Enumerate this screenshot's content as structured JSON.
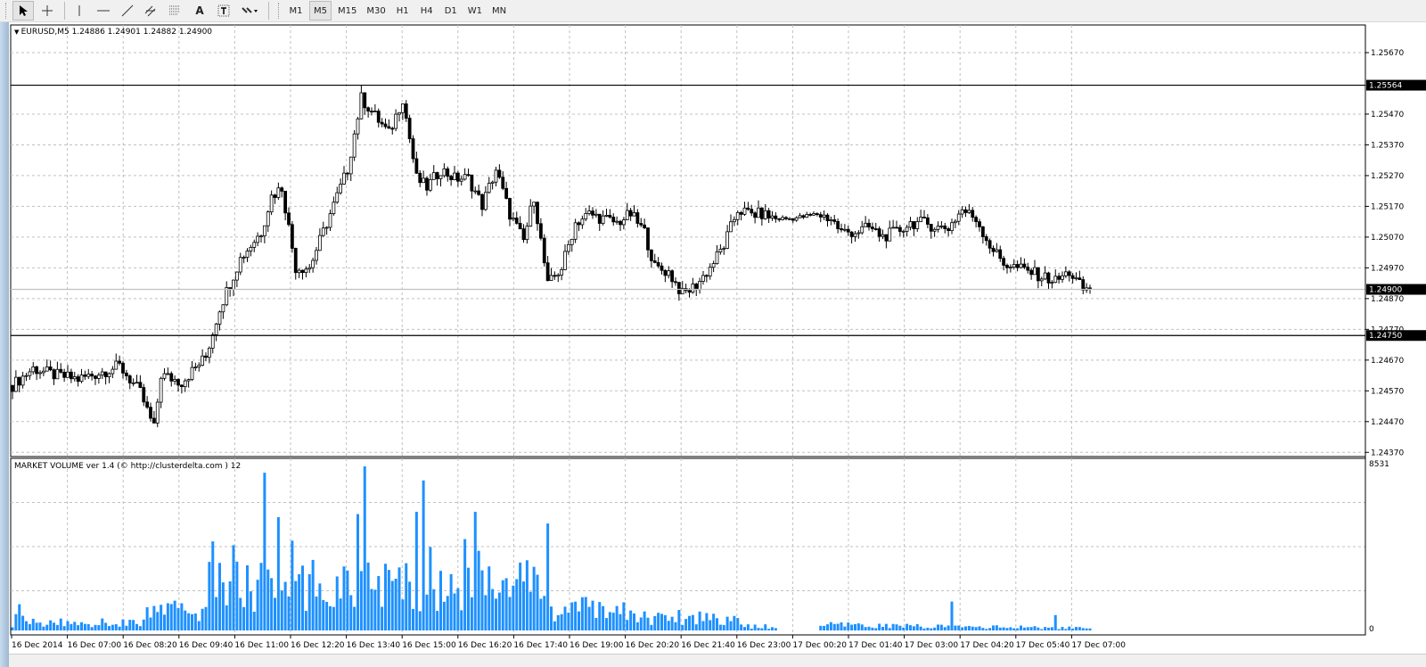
{
  "toolbar": {
    "tools": [
      "cursor",
      "crosshair",
      "vertical-line",
      "horizontal-line",
      "trendline",
      "equidistant-channel",
      "fibonacci",
      "text",
      "text-label",
      "arrows"
    ],
    "text_tool_label": "A",
    "timeframes": [
      "M1",
      "M5",
      "M15",
      "M30",
      "H1",
      "H4",
      "D1",
      "W1",
      "MN"
    ],
    "selected_timeframe": "M5"
  },
  "chart": {
    "header": "EURUSD,M5  1.24886 1.24901 1.24882 1.24900",
    "price_ticks": [
      "1.25670",
      "1.25470",
      "1.25370",
      "1.25270",
      "1.25170",
      "1.25070",
      "1.24970",
      "1.24870",
      "1.24770",
      "1.24670",
      "1.24570",
      "1.24470",
      "1.24370"
    ],
    "hlines": [
      {
        "price": 1.25564,
        "label": "1.25564",
        "color": "#000000"
      },
      {
        "price": 1.2475,
        "label": "1.24750",
        "color": "#000000"
      },
      {
        "price": 1.249,
        "label": "1.24900",
        "color": "#c0c0c0"
      }
    ],
    "time_labels": [
      "16 Dec 2014",
      "16 Dec 07:00",
      "16 Dec 08:20",
      "16 Dec 09:40",
      "16 Dec 11:00",
      "16 Dec 12:20",
      "16 Dec 13:40",
      "16 Dec 15:00",
      "16 Dec 16:20",
      "16 Dec 17:40",
      "16 Dec 19:00",
      "16 Dec 20:20",
      "16 Dec 21:40",
      "16 Dec 23:00",
      "17 Dec 00:20",
      "17 Dec 01:40",
      "17 Dec 03:00",
      "17 Dec 04:20",
      "17 Dec 05:40",
      "17 Dec 07:00"
    ]
  },
  "indicator": {
    "label": "MARKET VOLUME ver 1.4 (© http://clusterdelta.com ) 12",
    "max_label": "8531",
    "zero_label": "0",
    "color": "#1e90ff"
  },
  "chart_data": {
    "type": "candlestick",
    "symbol": "EURUSD",
    "timeframe": "M5",
    "bars": 313,
    "ylim": [
      1.2437,
      1.2567
    ],
    "close_anchors": [
      [
        0,
        1.24588
      ],
      [
        6,
        1.24643
      ],
      [
        12,
        1.24622
      ],
      [
        19,
        1.24608
      ],
      [
        25,
        1.24628
      ],
      [
        31,
        1.24651
      ],
      [
        37,
        1.24564
      ],
      [
        41,
        1.24448
      ],
      [
        43,
        1.24622
      ],
      [
        49,
        1.24599
      ],
      [
        56,
        1.2468
      ],
      [
        60,
        1.2484
      ],
      [
        66,
        1.25
      ],
      [
        72,
        1.25087
      ],
      [
        75,
        1.25203
      ],
      [
        78,
        1.25232
      ],
      [
        82,
        1.24971
      ],
      [
        86,
        1.24971
      ],
      [
        91,
        1.25116
      ],
      [
        97,
        1.2529
      ],
      [
        101,
        1.25522
      ],
      [
        105,
        1.25464
      ],
      [
        109,
        1.25406
      ],
      [
        113,
        1.25522
      ],
      [
        117,
        1.25261
      ],
      [
        120,
        1.25232
      ],
      [
        124,
        1.2529
      ],
      [
        128,
        1.25261
      ],
      [
        132,
        1.25261
      ],
      [
        136,
        1.25174
      ],
      [
        140,
        1.2529
      ],
      [
        144,
        1.25145
      ],
      [
        148,
        1.25058
      ],
      [
        151,
        1.25203
      ],
      [
        155,
        1.24913
      ],
      [
        159,
        1.24971
      ],
      [
        163,
        1.25116
      ],
      [
        167,
        1.25145
      ],
      [
        171,
        1.2513
      ],
      [
        175,
        1.25116
      ],
      [
        179,
        1.25145
      ],
      [
        183,
        1.25087
      ],
      [
        186,
        1.24971
      ],
      [
        190,
        1.24956
      ],
      [
        194,
        1.24884
      ],
      [
        198,
        1.24913
      ],
      [
        202,
        1.24971
      ],
      [
        206,
        1.25043
      ],
      [
        210,
        1.25159
      ],
      [
        214,
        1.25145
      ],
      [
        217,
        1.25145
      ],
      [
        221,
        1.2513
      ],
      [
        225,
        1.2513
      ],
      [
        229,
        1.25136
      ],
      [
        233,
        1.25145
      ],
      [
        237,
        1.2513
      ],
      [
        240,
        1.25087
      ],
      [
        244,
        1.25087
      ],
      [
        248,
        1.25101
      ],
      [
        252,
        1.25072
      ],
      [
        256,
        1.25087
      ],
      [
        260,
        1.25116
      ],
      [
        264,
        1.25116
      ],
      [
        268,
        1.25101
      ],
      [
        271,
        1.25101
      ],
      [
        275,
        1.25159
      ],
      [
        279,
        1.2513
      ],
      [
        283,
        1.25043
      ],
      [
        287,
        1.24985
      ],
      [
        291,
        1.2497
      ],
      [
        295,
        1.24956
      ],
      [
        298,
        1.24942
      ],
      [
        302,
        1.24927
      ],
      [
        306,
        1.24956
      ],
      [
        310,
        1.249
      ],
      [
        312,
        1.249
      ]
    ],
    "volume_base": [
      [
        0,
        400
      ],
      [
        2,
        960
      ],
      [
        4,
        400
      ],
      [
        38,
        400
      ],
      [
        39,
        1000
      ],
      [
        56,
        1100
      ],
      [
        57,
        2300
      ],
      [
        155,
        2300
      ],
      [
        156,
        1100
      ],
      [
        177,
        1100
      ],
      [
        178,
        700
      ],
      [
        210,
        700
      ],
      [
        211,
        200
      ],
      [
        221,
        200
      ],
      [
        222,
        0
      ],
      [
        233,
        0
      ],
      [
        234,
        280
      ],
      [
        312,
        120
      ]
    ],
    "volume_spikes": [
      [
        58,
        4630
      ],
      [
        64,
        4430
      ],
      [
        73,
        8200
      ],
      [
        77,
        5890
      ],
      [
        81,
        4670
      ],
      [
        96,
        3330
      ],
      [
        100,
        6050
      ],
      [
        102,
        8530
      ],
      [
        103,
        3530
      ],
      [
        117,
        6170
      ],
      [
        119,
        7800
      ],
      [
        121,
        4340
      ],
      [
        131,
        4750
      ],
      [
        134,
        6170
      ],
      [
        135,
        4140
      ],
      [
        138,
        3330
      ],
      [
        147,
        3530
      ],
      [
        149,
        3650
      ],
      [
        155,
        5560
      ],
      [
        272,
        1500
      ],
      [
        302,
        800
      ]
    ],
    "volume_max": 8531
  }
}
